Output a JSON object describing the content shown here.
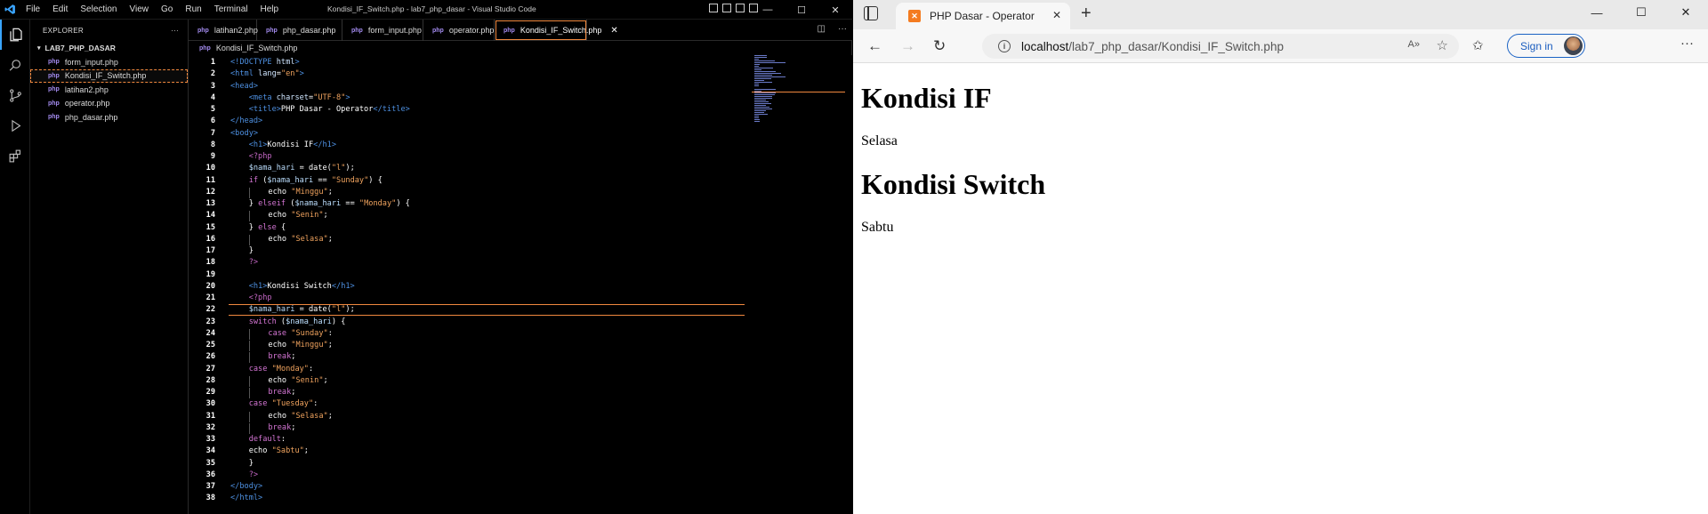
{
  "vscode": {
    "menu": [
      "File",
      "Edit",
      "Selection",
      "View",
      "Go",
      "Run",
      "Terminal",
      "Help"
    ],
    "window_title": "Kondisi_IF_Switch.php - lab7_php_dasar - Visual Studio Code",
    "explorer_label": "EXPLORER",
    "explorer_more": "···",
    "folder": "LAB7_PHP_DASAR",
    "files": [
      "form_input.php",
      "Kondisi_IF_Switch.php",
      "latihan2.php",
      "operator.php",
      "php_dasar.php"
    ],
    "selected_file_index": 1,
    "tabs": [
      "latihan2.php",
      "php_dasar.php",
      "form_input.php",
      "operator.php",
      "Kondisi_IF_Switch.php"
    ],
    "active_tab_index": 4,
    "breadcrumb": "Kondisi_IF_Switch.php",
    "file_icon": "php",
    "highlight_line": 22,
    "code": [
      [
        [
          "tag",
          "<!DOCTYPE "
        ],
        [
          "attr",
          "html"
        ],
        [
          "tag",
          ">"
        ]
      ],
      [
        [
          "tag",
          "<html "
        ],
        [
          "attr",
          "lang"
        ],
        [
          "plain",
          "="
        ],
        [
          "str",
          "\"en\""
        ],
        [
          "tag",
          ">"
        ]
      ],
      [
        [
          "tag",
          "<head>"
        ]
      ],
      [
        [
          "sp",
          "    "
        ],
        [
          "tag",
          "<meta "
        ],
        [
          "attr",
          "charset"
        ],
        [
          "plain",
          "="
        ],
        [
          "str",
          "\"UTF-8\""
        ],
        [
          "tag",
          ">"
        ]
      ],
      [
        [
          "sp",
          "    "
        ],
        [
          "tag",
          "<title>"
        ],
        [
          "plain",
          "PHP Dasar - Operator"
        ],
        [
          "tag",
          "</title>"
        ]
      ],
      [
        [
          "tag",
          "</head>"
        ]
      ],
      [
        [
          "tag",
          "<body>"
        ]
      ],
      [
        [
          "sp",
          "    "
        ],
        [
          "tag",
          "<h1>"
        ],
        [
          "plain",
          "Kondisi IF"
        ],
        [
          "tag",
          "</h1>"
        ]
      ],
      [
        [
          "sp",
          "    "
        ],
        [
          "php",
          "<?php"
        ]
      ],
      [
        [
          "sp",
          "    "
        ],
        [
          "var",
          "$nama_hari"
        ],
        [
          "plain",
          " = date("
        ],
        [
          "str",
          "\"l\""
        ],
        [
          "plain",
          ");"
        ]
      ],
      [
        [
          "sp",
          "    "
        ],
        [
          "kw",
          "if"
        ],
        [
          "plain",
          " ("
        ],
        [
          "var",
          "$nama_hari"
        ],
        [
          "plain",
          " == "
        ],
        [
          "str",
          "\"Sunday\""
        ],
        [
          "plain",
          ") {"
        ]
      ],
      [
        [
          "sp",
          "    "
        ],
        [
          "guide",
          ""
        ],
        [
          "sp",
          "    "
        ],
        [
          "plain",
          "echo "
        ],
        [
          "str",
          "\"Minggu\""
        ],
        [
          "plain",
          ";"
        ]
      ],
      [
        [
          "sp",
          "    "
        ],
        [
          "plain",
          "} "
        ],
        [
          "kw",
          "elseif"
        ],
        [
          "plain",
          " ("
        ],
        [
          "var",
          "$nama_hari"
        ],
        [
          "plain",
          " == "
        ],
        [
          "str",
          "\"Monday\""
        ],
        [
          "plain",
          ") {"
        ]
      ],
      [
        [
          "sp",
          "    "
        ],
        [
          "guide",
          ""
        ],
        [
          "sp",
          "    "
        ],
        [
          "plain",
          "echo "
        ],
        [
          "str",
          "\"Senin\""
        ],
        [
          "plain",
          ";"
        ]
      ],
      [
        [
          "sp",
          "    "
        ],
        [
          "plain",
          "} "
        ],
        [
          "kw",
          "else"
        ],
        [
          "plain",
          " {"
        ]
      ],
      [
        [
          "sp",
          "    "
        ],
        [
          "guide",
          ""
        ],
        [
          "sp",
          "    "
        ],
        [
          "plain",
          "echo "
        ],
        [
          "str",
          "\"Selasa\""
        ],
        [
          "plain",
          ";"
        ]
      ],
      [
        [
          "sp",
          "    "
        ],
        [
          "plain",
          "}"
        ]
      ],
      [
        [
          "sp",
          "    "
        ],
        [
          "php",
          "?>"
        ]
      ],
      [],
      [
        [
          "sp",
          "    "
        ],
        [
          "tag",
          "<h1>"
        ],
        [
          "plain",
          "Kondisi Switch"
        ],
        [
          "tag",
          "</h1>"
        ]
      ],
      [
        [
          "sp",
          "    "
        ],
        [
          "php",
          "<?php"
        ]
      ],
      [
        [
          "sp",
          "    "
        ],
        [
          "var",
          "$nama_hari"
        ],
        [
          "plain",
          " = date("
        ],
        [
          "str",
          "\"l\""
        ],
        [
          "plain",
          ");"
        ]
      ],
      [
        [
          "sp",
          "    "
        ],
        [
          "kw",
          "switch"
        ],
        [
          "plain",
          " ("
        ],
        [
          "var",
          "$nama_hari"
        ],
        [
          "plain",
          ") {"
        ]
      ],
      [
        [
          "sp",
          "    "
        ],
        [
          "guide",
          ""
        ],
        [
          "sp",
          "    "
        ],
        [
          "kw",
          "case"
        ],
        [
          "plain",
          " "
        ],
        [
          "str",
          "\"Sunday\""
        ],
        [
          "plain",
          ":"
        ]
      ],
      [
        [
          "sp",
          "    "
        ],
        [
          "guide",
          ""
        ],
        [
          "sp",
          "    "
        ],
        [
          "plain",
          "echo "
        ],
        [
          "str",
          "\"Minggu\""
        ],
        [
          "plain",
          ";"
        ]
      ],
      [
        [
          "sp",
          "    "
        ],
        [
          "guide",
          ""
        ],
        [
          "sp",
          "    "
        ],
        [
          "kw",
          "break"
        ],
        [
          "plain",
          ";"
        ]
      ],
      [
        [
          "sp",
          "    "
        ],
        [
          "kw",
          "case"
        ],
        [
          "plain",
          " "
        ],
        [
          "str",
          "\"Monday\""
        ],
        [
          "plain",
          ":"
        ]
      ],
      [
        [
          "sp",
          "    "
        ],
        [
          "guide",
          ""
        ],
        [
          "sp",
          "    "
        ],
        [
          "plain",
          "echo "
        ],
        [
          "str",
          "\"Senin\""
        ],
        [
          "plain",
          ";"
        ]
      ],
      [
        [
          "sp",
          "    "
        ],
        [
          "guide",
          ""
        ],
        [
          "sp",
          "    "
        ],
        [
          "kw",
          "break"
        ],
        [
          "plain",
          ";"
        ]
      ],
      [
        [
          "sp",
          "    "
        ],
        [
          "kw",
          "case"
        ],
        [
          "plain",
          " "
        ],
        [
          "str",
          "\"Tuesday\""
        ],
        [
          "plain",
          ":"
        ]
      ],
      [
        [
          "sp",
          "    "
        ],
        [
          "guide",
          ""
        ],
        [
          "sp",
          "    "
        ],
        [
          "plain",
          "echo "
        ],
        [
          "str",
          "\"Selasa\""
        ],
        [
          "plain",
          ";"
        ]
      ],
      [
        [
          "sp",
          "    "
        ],
        [
          "guide",
          ""
        ],
        [
          "sp",
          "    "
        ],
        [
          "kw",
          "break"
        ],
        [
          "plain",
          ";"
        ]
      ],
      [
        [
          "sp",
          "    "
        ],
        [
          "kw",
          "default"
        ],
        [
          "plain",
          ":"
        ]
      ],
      [
        [
          "sp",
          "    "
        ],
        [
          "plain",
          "echo "
        ],
        [
          "str",
          "\"Sabtu\""
        ],
        [
          "plain",
          ";"
        ]
      ],
      [
        [
          "sp",
          "    "
        ],
        [
          "plain",
          "}"
        ]
      ],
      [
        [
          "sp",
          "    "
        ],
        [
          "php",
          "?>"
        ]
      ],
      [
        [
          "tag",
          "</body>"
        ]
      ],
      [
        [
          "tag",
          "</html>"
        ]
      ]
    ],
    "syntax_colors": {
      "tag": "#4d8fe0",
      "attr": "#cfe5ff",
      "str": "#f0a35e",
      "kw": "#d576d5",
      "var": "#bcdfff",
      "php": "#c266c2"
    }
  },
  "browser": {
    "tab_title": "PHP Dasar - Operator",
    "favicon": "xampp-icon",
    "url_host": "localhost",
    "url_path": "/lab7_php_dasar/Kondisi_IF_Switch.php",
    "sign_in_label": "Sign in",
    "page": {
      "heading1": "Kondisi IF",
      "text1": "Selasa",
      "heading2": "Kondisi Switch",
      "text2": "Sabtu"
    }
  }
}
